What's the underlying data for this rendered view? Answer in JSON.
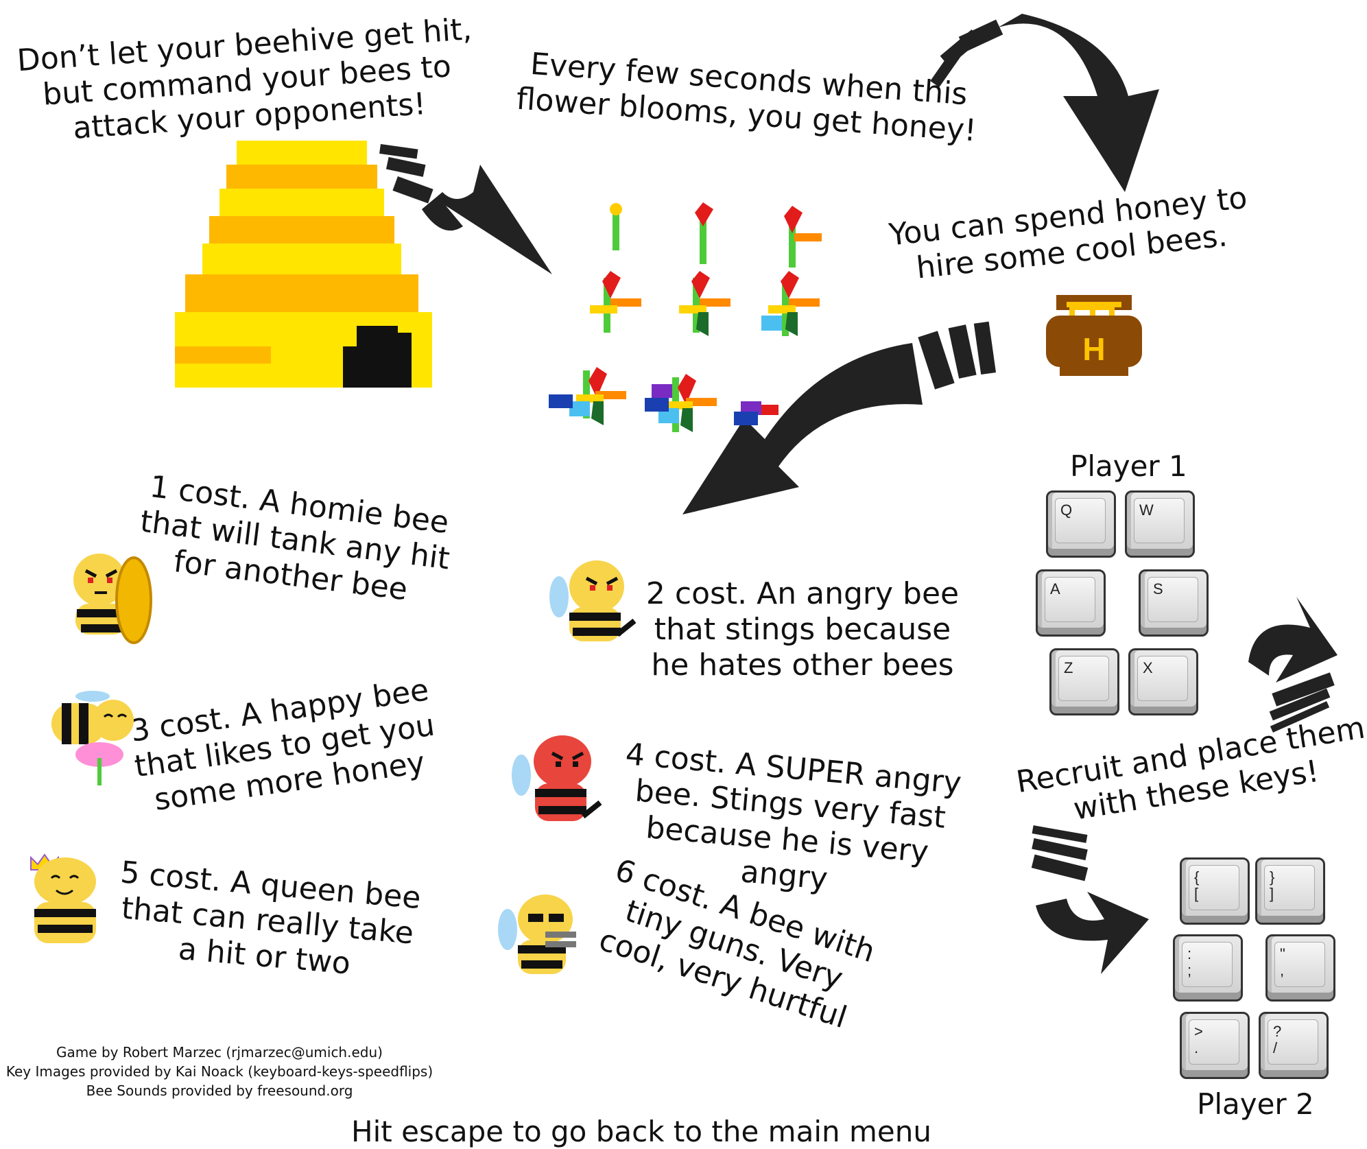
{
  "texts": {
    "intro": "Don’t let your beehive get hit, but command your bees to attack your opponents!",
    "flower": "Every few seconds when this flower blooms, you get honey!",
    "honey": "You can spend honey to hire some cool bees.",
    "bee1": "1 cost. A homie bee that will tank any hit for another bee",
    "bee2": "2 cost. An angry bee that stings because he hates other bees",
    "bee3": "3 cost. A happy bee that likes to get you some more honey",
    "bee4": "4 cost. A SUPER angry bee. Stings very fast because he is very angry",
    "bee5": "5 cost. A queen bee that can really take a hit or two",
    "bee6": "6 cost. A bee with tiny guns. Very cool, very hurtful",
    "recruit": "Recruit and place them with these keys!",
    "escape": "Hit escape to go back to the main menu"
  },
  "credits": [
    "Game by Robert Marzec (rjmarzec@umich.edu)",
    "Key Images provided by Kai Noack (keyboard-keys-speedflips)",
    "Bee Sounds provided by freesound.org"
  ],
  "player1": {
    "label": "Player 1",
    "keys": [
      "Q",
      "W",
      "A",
      "S",
      "Z",
      "X"
    ]
  },
  "player2": {
    "label": "Player 2",
    "keys": [
      "{\n[",
      "}\n]",
      ":\n;",
      "\"\n,",
      ">\n.",
      "?\n/"
    ]
  },
  "honey_pot_letter": "H",
  "colors": {
    "hive_yellow": "#ffe500",
    "hive_orange": "#ffb800",
    "arrow": "#222222",
    "pot_brown": "#8b4a06"
  },
  "icons": [
    "beehive-icon",
    "flower-growth-icon",
    "honey-pot-icon",
    "homie-bee-icon",
    "angry-bee-icon",
    "happy-bee-icon",
    "super-angry-bee-icon",
    "queen-bee-icon",
    "gun-bee-icon"
  ]
}
